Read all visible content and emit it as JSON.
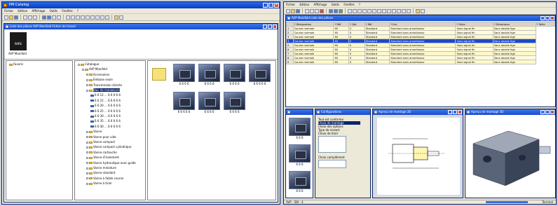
{
  "left_window": {
    "title": "PM Catalog",
    "menu": [
      "Fichier",
      "Edition",
      "Affichage",
      "Outils",
      "Fenêtre",
      "?"
    ],
    "doc_title": "Liste des pièces   AVP Manifold Fichier de travail",
    "brand": {
      "logo_text": "WIRE",
      "caption": "AVP Manifold"
    },
    "left_tree": [
      {
        "label": "Favoris"
      }
    ],
    "tree": [
      {
        "label": "Catalogue",
        "level": 0,
        "icon": "folder"
      },
      {
        "label": "AVP Manifold",
        "level": 1,
        "icon": "folder"
      },
      {
        "label": "Accessoires",
        "level": 2,
        "icon": "folder"
      },
      {
        "label": "Embase seule",
        "level": 2,
        "icon": "folder"
      },
      {
        "label": "Transmission directe",
        "level": 2,
        "icon": "folder"
      },
      {
        "label": "Bloc de manœuvre",
        "level": 2,
        "icon": "folder",
        "selected": true
      },
      {
        "label": "6 6 12 ... 6 6 6 6 6",
        "level": 3,
        "icon": "leaf"
      },
      {
        "label": "6 6 15 ... 6 6 6 6 6",
        "level": 3,
        "icon": "leaf"
      },
      {
        "label": "6 6 20 ... 6 6 6 6 6",
        "level": 3,
        "icon": "leaf"
      },
      {
        "label": "6 6 25 ... 6 6 6 6 6",
        "level": 3,
        "icon": "leaf"
      },
      {
        "label": "6 6 30 ... 6 6 6 6 6",
        "level": 3,
        "icon": "leaf"
      },
      {
        "label": "6 6 35 ... 6 6 6 6 6",
        "level": 3,
        "icon": "leaf"
      },
      {
        "label": "6 6 40 ... 6 6 6 6 6",
        "level": 3,
        "icon": "leaf"
      },
      {
        "label": "Vanne",
        "level": 2,
        "icon": "folder"
      },
      {
        "label": "Vanne pour vide",
        "level": 2,
        "icon": "folder"
      },
      {
        "label": "Vanne compact",
        "level": 2,
        "icon": "folder"
      },
      {
        "label": "Vanne compact cylindrique",
        "level": 2,
        "icon": "folder"
      },
      {
        "label": "Vanne cartouche",
        "level": 2,
        "icon": "folder"
      },
      {
        "label": "Vanne d'isolement",
        "level": 2,
        "icon": "folder"
      },
      {
        "label": "Vanne hydraulique avec guide",
        "level": 2,
        "icon": "folder"
      },
      {
        "label": "Vanne miniature",
        "level": 2,
        "icon": "folder"
      },
      {
        "label": "Vanne standard",
        "level": 2,
        "icon": "folder"
      },
      {
        "label": "Vanne à faible course",
        "level": 2,
        "icon": "folder"
      },
      {
        "label": "Vanne à tiroir",
        "level": 2,
        "icon": "folder"
      }
    ],
    "thumbnails": [
      {
        "label": "6 6 6 6"
      },
      {
        "label": "6 6 6 6"
      },
      {
        "label": "6 6 6 6"
      },
      {
        "label": "6 6 6 6 6"
      },
      {
        "label": "6 6 6 6 6"
      },
      {
        "label": "6 6 6 6"
      },
      {
        "label": "6 6 6 6"
      }
    ]
  },
  "right_window": {
    "menu": [
      "Fichier",
      "Edition",
      "Affichage",
      "Outils",
      "Fenêtre",
      "?"
    ],
    "table_title": "AVP Manifold Liste des pièces",
    "table_headers": [
      "",
      "* Désignation",
      "* Réf",
      "* Qté",
      "* Réf",
      "* Ext",
      "* Série",
      "* Dimension",
      "* Taille"
    ],
    "table_rows": [
      [
        "1",
        "Course normale",
        "60",
        "0",
        "Standard",
        "Standard sans amortisseur",
        "Sans signal fin",
        "Sans double tige"
      ],
      [
        "2",
        "Course normale",
        "60",
        "0",
        "Standard",
        "Standard sans amortisseur",
        "Sans signal fin",
        "Sans double tige"
      ],
      [
        "3",
        "Course normale",
        "60",
        "0",
        "Standard",
        "Standard sans amortisseur",
        "Sans signal fin",
        "Sans double tige"
      ],
      [
        "4",
        "Course normale",
        "60",
        "0",
        "Standard",
        "Standard sans amortisseur",
        "Sans signal fin",
        "Sans double tige"
      ],
      [
        "5",
        "Course normale",
        "60",
        "0",
        "Standard",
        "Standard sans amortisseur",
        "Sans signal fin",
        "Sans double tige"
      ],
      [
        "6",
        "Course normale",
        "60",
        "0",
        "Standard",
        "Standard sans amortisseur",
        "Sans signal fin",
        "Sans double tige"
      ],
      [
        "7",
        "Course normale",
        "60",
        "0",
        "Standard",
        "Standard sans amortisseur",
        "Sans signal fin",
        "Sans double tige"
      ],
      [
        "8",
        "Course normale",
        "60",
        "0",
        "Standard",
        "Standard sans amortisseur",
        "Sans signal fin",
        "Sans double tige"
      ],
      [
        "9",
        "Course normale",
        "60",
        "0",
        "Standard",
        "Standard sans amortisseur",
        "Sans signal fin",
        "Sans double tige"
      ]
    ],
    "small_thumbs": [
      {
        "label": "6 6 6"
      },
      {
        "label": "6 6 6"
      },
      {
        "label": "6 6 6"
      }
    ],
    "config_title": "Configurations",
    "config_lines": [
      "Tout est conforme",
      "Choix de montage",
      "Choix des options",
      "Type de ressort",
      "Choix de tiroir"
    ],
    "config_label2": "Choix complément",
    "drawing_title": "Aperçu de montage 2D",
    "view3d_title": "Aperçu de montage 3D",
    "status": "AVP - SW - 4",
    "status_right": "Terminé"
  }
}
